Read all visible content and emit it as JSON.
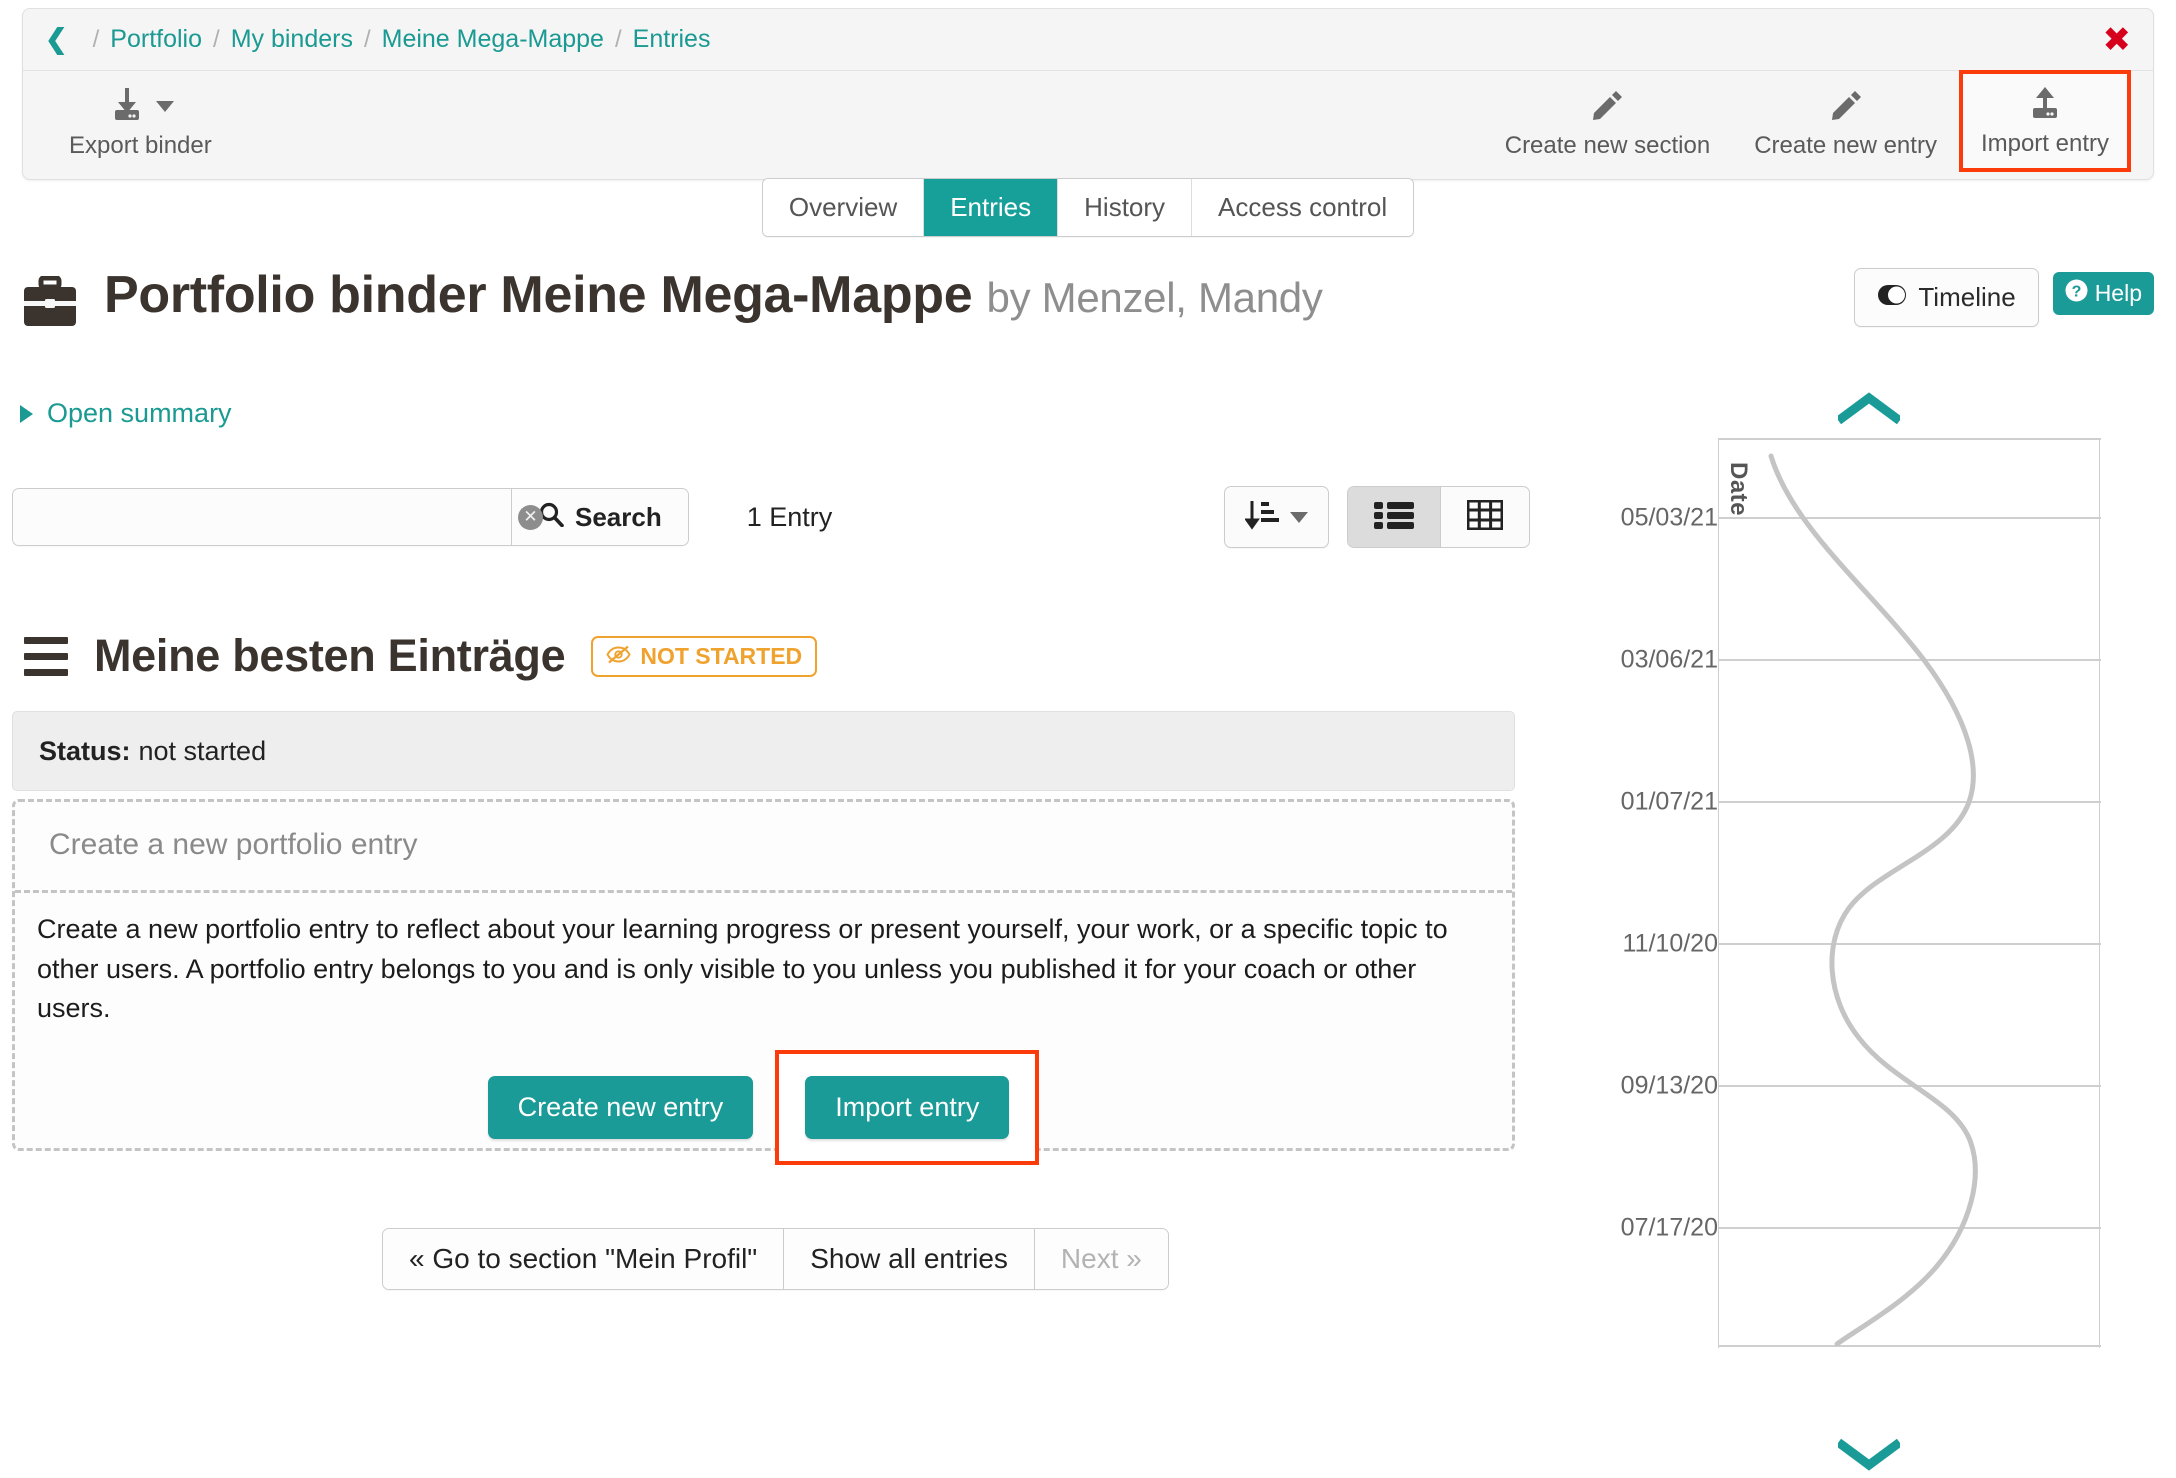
{
  "breadcrumb": {
    "back_icon": "chevron-left-icon",
    "items": [
      "Portfolio",
      "My binders",
      "Meine Mega-Mappe",
      "Entries"
    ],
    "separator": "/"
  },
  "header": {
    "close_label": "✖",
    "toolbar": {
      "export": {
        "label": "Export binder",
        "icon": "download-binder-icon",
        "has_dropdown": true
      },
      "create_section": {
        "label": "Create new section",
        "icon": "pencil-icon"
      },
      "create_entry": {
        "label": "Create new entry",
        "icon": "pencil-icon"
      },
      "import_entry": {
        "label": "Import entry",
        "icon": "upload-icon",
        "highlighted": true
      }
    }
  },
  "tabs": [
    {
      "label": "Overview",
      "active": false
    },
    {
      "label": "Entries",
      "active": true
    },
    {
      "label": "History",
      "active": false
    },
    {
      "label": "Access control",
      "active": false
    }
  ],
  "title": {
    "icon": "briefcase-icon",
    "main": "Portfolio binder Meine Mega-Mappe",
    "by": "by Menzel, Mandy"
  },
  "title_actions": {
    "timeline": {
      "label": "Timeline",
      "icon": "toggle-on-icon"
    },
    "help": {
      "label": "Help",
      "icon": "question-circle-icon"
    }
  },
  "open_summary": {
    "label": "Open summary",
    "icon": "triangle-right-icon"
  },
  "search": {
    "value": "",
    "placeholder": "",
    "clear_icon": "clear-circle-icon",
    "button_label": "Search",
    "button_icon": "magnifier-icon",
    "result_count": "1 Entry"
  },
  "view_controls": {
    "sort": {
      "icon": "sort-amount-down-icon",
      "has_dropdown": true
    },
    "list_view": {
      "icon": "list-view-icon",
      "active": true
    },
    "table_view": {
      "icon": "table-view-icon",
      "active": false
    }
  },
  "section": {
    "menu_icon": "hamburger-icon",
    "title": "Meine besten Einträge",
    "badge": {
      "label": "NOT STARTED",
      "icon": "eye-slash-icon",
      "color": "#f0a22e"
    },
    "status_label": "Status:",
    "status_value": "not started"
  },
  "create_panel": {
    "heading": "Create a new portfolio entry",
    "body": "Create a new portfolio entry to reflect about your learning progress or present yourself, your work, or a specific topic to other users. A portfolio entry belongs to you and is only visible to you unless you published it for your coach or other users.",
    "create_button": "Create new entry",
    "import_button": "Import entry"
  },
  "pager": {
    "prev": "« Go to section \"Mein Profil\"",
    "all": "Show all entries",
    "next": "Next »"
  },
  "timeline_chart": {
    "axis_title": "Date",
    "scroll_up_icon": "chevron-up-icon",
    "scroll_down_icon": "chevron-down-icon",
    "tick_labels": [
      "05/03/21",
      "03/06/21",
      "01/07/21",
      "11/10/20",
      "09/13/20",
      "07/17/20"
    ]
  },
  "colors": {
    "accent_teal": "#1b9b98",
    "link_teal": "#1a9a92",
    "highlight_red": "#fb3b0a",
    "close_red": "#d6001c",
    "badge_orange": "#f0a22e"
  }
}
